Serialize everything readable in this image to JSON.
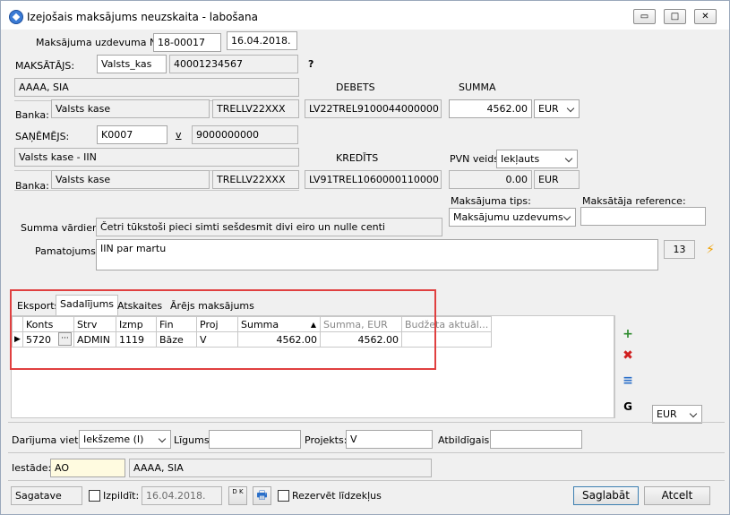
{
  "window": {
    "title": "Izejošais maksājums neuzskaita - labošana",
    "minimize_glyph": "▭",
    "maximize_glyph": "□",
    "close_glyph": "✕"
  },
  "header": {
    "order_no_label": "Maksājuma uzdevuma Nr.",
    "order_no": "18-00017",
    "date": "16.04.2018."
  },
  "payer": {
    "label": "MAKSĀTĀJS:",
    "code": "Valsts_kas",
    "reg_no": "40001234567",
    "help": "?",
    "name": "AAAA, SIA",
    "bank_label": "Banka:",
    "bank_name": "Valsts kase",
    "bank_swift": "TRELLV22XXX"
  },
  "debit": {
    "label": "DEBETS",
    "account": "LV22TREL9100044000000"
  },
  "sum": {
    "label": "SUMMA",
    "amount": "4562.00",
    "currency": "EUR"
  },
  "receiver": {
    "label": "SAŅĒMĒJS:",
    "code": "K0007",
    "v": "v",
    "reg_no": "9000000000",
    "name": "Valsts kase - IIN",
    "bank_label": "Banka:",
    "bank_name": "Valsts kase",
    "bank_swift": "TRELLV22XXX"
  },
  "credit": {
    "label": "KREDĪTS",
    "account": "LV91TREL1060000110000"
  },
  "vat": {
    "label": "PVN veids:",
    "type": "Iekļauts",
    "amount": "0.00",
    "currency": "EUR"
  },
  "payment_type": {
    "label": "Maksājuma tips:",
    "value": "Maksājumu uzdevums"
  },
  "payer_ref": {
    "label": "Maksātāja reference:",
    "value": ""
  },
  "words": {
    "label": "Summa vārdiem:",
    "value": "Četri tūkstoši pieci simti sešdesmit divi eiro un nulle centi"
  },
  "basis": {
    "label": "Pamatojums:",
    "value": "IIN par martu",
    "count": "13"
  },
  "tabs": [
    "Eksports",
    "Sadalījums",
    "Atskaites",
    "Ārējs maksājums"
  ],
  "grid": {
    "columns": [
      "Konts",
      "Strv",
      "Izmp",
      "Fin",
      "Proj",
      "Summa",
      "Summa, EUR",
      "Budžeta aktuāl..."
    ],
    "rows": [
      {
        "konts": "5720",
        "strv": "ADMIN",
        "izmp": "1119",
        "fin": "Bāze",
        "proj": "V",
        "summa": "4562.00",
        "summa_eur": "4562.00",
        "budzeta": ""
      }
    ],
    "row_pointer": "▶",
    "ellipsis": "···",
    "sort_glyph": "▲"
  },
  "side": {
    "add_glyph": "+",
    "delete_glyph": "✖",
    "import_glyph": "≡",
    "g_label": "G",
    "currency": "EUR"
  },
  "footer": {
    "place_label": "Darījuma vieta:",
    "place": "Iekšzeme (I)",
    "contract_label": "Līgums:",
    "contract": "",
    "project_label": "Projekts:",
    "project": "V",
    "responsible_label": "Atbildīgais:",
    "responsible": "",
    "institution_label": "Iestāde:",
    "institution_code": "AO",
    "institution_name": "AAAA, SIA"
  },
  "bottom": {
    "status": "Sagatave",
    "execute_label": "Izpildīt:",
    "execute_date": "16.04.2018.",
    "dk_label": "D K",
    "reserve_label": "Rezervēt līdzekļus",
    "save_label": "Saglabāt",
    "cancel_label": "Atcelt"
  },
  "colors": {
    "highlight_border": "#e04040",
    "help_green": "#2e9e2e",
    "lightning": "#f0a000",
    "delete_red": "#d02020",
    "add_green": "#2e8b2e",
    "import_blue": "#2a6fc9"
  }
}
